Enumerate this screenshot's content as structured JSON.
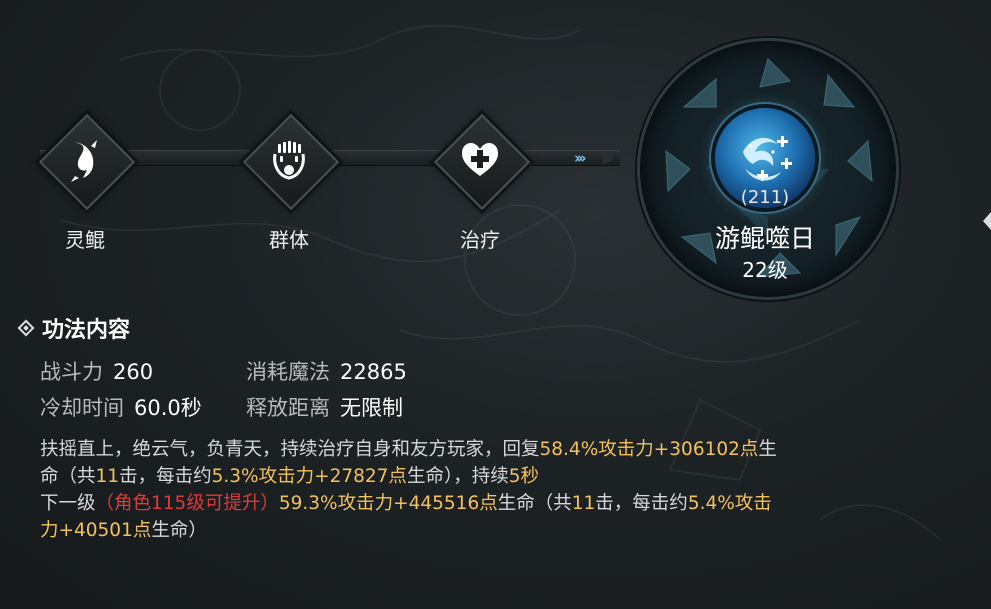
{
  "path": {
    "nodes": [
      {
        "label": "灵鲲",
        "icon": "fish-dragon-icon"
      },
      {
        "label": "群体",
        "icon": "group-crown-icon"
      },
      {
        "label": "治疗",
        "icon": "heart-plus-icon"
      }
    ],
    "arrows": "›››"
  },
  "skill": {
    "id": "(211)",
    "name": "游鲲噬日",
    "level": "22级",
    "icon": "swimming-kun-orb-icon"
  },
  "section": {
    "title": "功法内容"
  },
  "stats": {
    "power_label": "战斗力",
    "power_value": "260",
    "mana_label": "消耗魔法",
    "mana_value": "22865",
    "cooldown_label": "冷却时间",
    "cooldown_value": "60.0秒",
    "range_label": "释放距离",
    "range_value": "无限制"
  },
  "description": {
    "p1_a": "扶摇直上，绝云气，负青天，持续治疗自身和友方玩家，回复",
    "p1_b": "58.4%攻击力+306102点",
    "p1_c": "生",
    "p2_a": "命（共",
    "p2_b": "11",
    "p2_c": "击，每击约",
    "p2_d": "5.3%攻击力+27827点",
    "p2_e": "生命），持续",
    "p2_f": "5秒",
    "next_label": "下一级",
    "next_req": "（角色115级可提升）",
    "next_b": "59.3%攻击力+445516点",
    "next_c": "生命（共",
    "next_d": "11",
    "next_e": "击，每击约",
    "next_f": "5.4%攻击",
    "p4_a": "力+40501点",
    "p4_b": "生命）"
  },
  "colors": {
    "accent_gold": "#f3c25b",
    "warning_red": "#e03a3a",
    "skill_blue": "#4fb6e8"
  }
}
